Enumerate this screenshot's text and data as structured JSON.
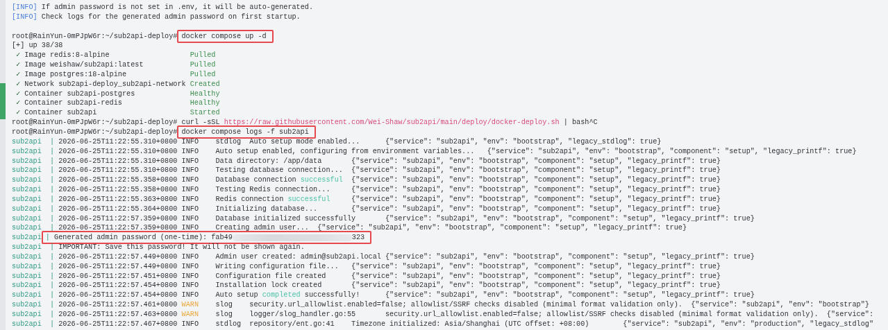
{
  "terminal": {
    "lines": [
      {
        "kind": "text",
        "segments": [
          {
            "text": "[INFO]",
            "kind": "info"
          },
          {
            "text": " If admin password is not set in .env, it will be auto-generated.",
            "kind": "plain"
          }
        ]
      },
      {
        "kind": "text",
        "segments": [
          {
            "text": "[INFO]",
            "kind": "info"
          },
          {
            "text": " Check logs for the generated admin password on first startup.",
            "kind": "plain"
          }
        ]
      },
      {
        "kind": "blank"
      },
      {
        "kind": "text",
        "segments": [
          {
            "text": "root@RainYun-0mPJpW6r:~/sub2api-deploy#",
            "kind": "prompt"
          },
          {
            "kind": "box",
            "segments": [
              {
                "text": "docker compose up -d",
                "kind": "command"
              }
            ]
          }
        ]
      },
      {
        "kind": "text",
        "segments": [
          {
            "text": "[+] up 38/38",
            "kind": "plain"
          }
        ]
      },
      {
        "kind": "text",
        "segments": [
          {
            "text": "✓",
            "kind": "check"
          },
          {
            "text": "Image redis:8-alpine",
            "kind": "resource"
          },
          {
            "text": "Pulled",
            "kind": "status"
          }
        ]
      },
      {
        "kind": "text",
        "segments": [
          {
            "text": "✓",
            "kind": "check"
          },
          {
            "text": "Image weishaw/sub2api:latest",
            "kind": "resource"
          },
          {
            "text": "Pulled",
            "kind": "status"
          }
        ]
      },
      {
        "kind": "text",
        "segments": [
          {
            "text": "✓",
            "kind": "check"
          },
          {
            "text": "Image postgres:18-alpine",
            "kind": "resource"
          },
          {
            "text": "Pulled",
            "kind": "status"
          }
        ]
      },
      {
        "kind": "text",
        "segments": [
          {
            "text": "✓",
            "kind": "check"
          },
          {
            "text": "Network sub2api-deploy_sub2api-network",
            "kind": "resource"
          },
          {
            "text": "Created",
            "kind": "status"
          }
        ]
      },
      {
        "kind": "text",
        "segments": [
          {
            "text": "✓",
            "kind": "check"
          },
          {
            "text": "Container sub2api-postgres",
            "kind": "resource"
          },
          {
            "text": "Healthy",
            "kind": "status"
          }
        ]
      },
      {
        "kind": "text",
        "segments": [
          {
            "text": "✓",
            "kind": "check"
          },
          {
            "text": "Container sub2api-redis",
            "kind": "resource"
          },
          {
            "text": "Healthy",
            "kind": "status"
          }
        ]
      },
      {
        "kind": "text",
        "segments": [
          {
            "text": "✓",
            "kind": "check"
          },
          {
            "text": "Container sub2api",
            "kind": "resource"
          },
          {
            "text": "Started",
            "kind": "status"
          }
        ]
      },
      {
        "kind": "text",
        "segments": [
          {
            "text": "root@RainYun-0mPJpW6r:~/sub2api-deploy#",
            "kind": "prompt"
          },
          {
            "text": " curl -sSL ",
            "kind": "plain"
          },
          {
            "text": "https://raw.githubusercontent.com/Wei-Shaw/sub2api/main/deploy/docker-deploy.sh",
            "kind": "url"
          },
          {
            "text": " | bash^C",
            "kind": "plain"
          }
        ]
      },
      {
        "kind": "text",
        "segments": [
          {
            "text": "root@RainYun-0mPJpW6r:~/sub2api-deploy#",
            "kind": "prompt"
          },
          {
            "kind": "box",
            "segments": [
              {
                "text": "docker compose logs -f sub2api",
                "kind": "command"
              }
            ]
          }
        ]
      },
      {
        "kind": "text",
        "segments": [
          {
            "text": "sub2api  |",
            "kind": "service"
          },
          {
            "text": " 2026-06-25T11:22:55.310+0800\tINFO\tstdlog\tAuto setup mode enabled...\t{\"service\": \"sub2api\", \"env\": \"bootstrap\", \"legacy_stdlog\": true}",
            "kind": "plain"
          }
        ]
      },
      {
        "kind": "text",
        "segments": [
          {
            "text": "sub2api  |",
            "kind": "service"
          },
          {
            "text": " 2026-06-25T11:22:55.310+0800\tINFO\tAuto setup enabled, configuring from environment variables...\t{\"service\": \"sub2api\", \"env\": \"bootstrap\", \"component\": \"setup\", \"legacy_printf\": true}",
            "kind": "plain"
          }
        ]
      },
      {
        "kind": "text",
        "segments": [
          {
            "text": "sub2api  |",
            "kind": "service"
          },
          {
            "text": " 2026-06-25T11:22:55.310+0800\tINFO\tData directory: /app/data\t{\"service\": \"sub2api\", \"env\": \"bootstrap\", \"component\": \"setup\", \"legacy_printf\": true}",
            "kind": "plain"
          }
        ]
      },
      {
        "kind": "text",
        "segments": [
          {
            "text": "sub2api  |",
            "kind": "service"
          },
          {
            "text": " 2026-06-25T11:22:55.310+0800\tINFO\tTesting database connection...\t{\"service\": \"sub2api\", \"env\": \"bootstrap\", \"component\": \"setup\", \"legacy_printf\": true}",
            "kind": "plain"
          }
        ]
      },
      {
        "kind": "text",
        "segments": [
          {
            "text": "sub2api  |",
            "kind": "service"
          },
          {
            "text": " 2026-06-25T11:22:55.358+0800\tINFO\tDatabase connection ",
            "kind": "plain"
          },
          {
            "text": "successful",
            "kind": "success"
          },
          {
            "text": "\t{\"service\": \"sub2api\", \"env\": \"bootstrap\", \"component\": \"setup\", \"legacy_printf\": true}",
            "kind": "plain"
          }
        ]
      },
      {
        "kind": "text",
        "segments": [
          {
            "text": "sub2api  |",
            "kind": "service"
          },
          {
            "text": " 2026-06-25T11:22:55.358+0800\tINFO\tTesting Redis connection...\t{\"service\": \"sub2api\", \"env\": \"bootstrap\", \"component\": \"setup\", \"legacy_printf\": true}",
            "kind": "plain"
          }
        ]
      },
      {
        "kind": "text",
        "segments": [
          {
            "text": "sub2api  |",
            "kind": "service"
          },
          {
            "text": " 2026-06-25T11:22:55.363+0800\tINFO\tRedis connection ",
            "kind": "plain"
          },
          {
            "text": "successful",
            "kind": "success"
          },
          {
            "text": "\t{\"service\": \"sub2api\", \"env\": \"bootstrap\", \"component\": \"setup\", \"legacy_printf\": true}",
            "kind": "plain"
          }
        ]
      },
      {
        "kind": "text",
        "segments": [
          {
            "text": "sub2api  |",
            "kind": "service"
          },
          {
            "text": " 2026-06-25T11:22:55.364+0800\tINFO\tInitializing database...\t{\"service\": \"sub2api\", \"env\": \"bootstrap\", \"component\": \"setup\", \"legacy_printf\": true}",
            "kind": "plain"
          }
        ]
      },
      {
        "kind": "text",
        "segments": [
          {
            "text": "sub2api  |",
            "kind": "service"
          },
          {
            "text": " 2026-06-25T11:22:57.359+0800\tINFO\tDatabase initialized successfully\t{\"service\": \"sub2api\", \"env\": \"bootstrap\", \"component\": \"setup\", \"legacy_printf\": true}",
            "kind": "plain"
          }
        ]
      },
      {
        "kind": "text",
        "segments": [
          {
            "text": "sub2api  |",
            "kind": "service"
          },
          {
            "text": " 2026-06-25T11:22:57.359+0800\tINFO\tCreating admin user...\t{\"service\": \"sub2api\", \"env\": \"bootstrap\", \"component\": \"setup\", \"legacy_printf\": true}",
            "kind": "plain"
          }
        ]
      },
      {
        "kind": "text",
        "segments": [
          {
            "text": "sub2api",
            "kind": "service"
          },
          {
            "kind": "box",
            "segments": [
              {
                "text": "|",
                "kind": "service"
              },
              {
                "text": " Generated admin password (one-time): fab49",
                "kind": "plain"
              },
              {
                "kind": "redacted"
              },
              {
                "text": "323",
                "kind": "plain"
              }
            ]
          }
        ]
      },
      {
        "kind": "text",
        "segments": [
          {
            "text": "sub2api  |",
            "kind": "service"
          },
          {
            "text": " IMPORTANT: Save this password! It will not be shown again.",
            "kind": "plain"
          }
        ]
      },
      {
        "kind": "text",
        "segments": [
          {
            "text": "sub2api  |",
            "kind": "service"
          },
          {
            "text": " 2026-06-25T11:22:57.449+0800\tINFO\tAdmin user created: admin@sub2api.local\t{\"service\": \"sub2api\", \"env\": \"bootstrap\", \"component\": \"setup\", \"legacy_printf\": true}",
            "kind": "plain"
          }
        ]
      },
      {
        "kind": "text",
        "segments": [
          {
            "text": "sub2api  |",
            "kind": "service"
          },
          {
            "text": " 2026-06-25T11:22:57.449+0800\tINFO\tWriting configuration file...\t{\"service\": \"sub2api\", \"env\": \"bootstrap\", \"component\": \"setup\", \"legacy_printf\": true}",
            "kind": "plain"
          }
        ]
      },
      {
        "kind": "text",
        "segments": [
          {
            "text": "sub2api  |",
            "kind": "service"
          },
          {
            "text": " 2026-06-25T11:22:57.451+0800\tINFO\tConfiguration file created\t{\"service\": \"sub2api\", \"env\": \"bootstrap\", \"component\": \"setup\", \"legacy_printf\": true}",
            "kind": "plain"
          }
        ]
      },
      {
        "kind": "text",
        "segments": [
          {
            "text": "sub2api  |",
            "kind": "service"
          },
          {
            "text": " 2026-06-25T11:22:57.454+0800\tINFO\tInstallation lock created\t{\"service\": \"sub2api\", \"env\": \"bootstrap\", \"component\": \"setup\", \"legacy_printf\": true}",
            "kind": "plain"
          }
        ]
      },
      {
        "kind": "text",
        "segments": [
          {
            "text": "sub2api  |",
            "kind": "service"
          },
          {
            "text": " 2026-06-25T11:22:57.454+0800\tINFO\tAuto setup ",
            "kind": "plain"
          },
          {
            "text": "completed",
            "kind": "success"
          },
          {
            "text": " successfully!\t{\"service\": \"sub2api\", \"env\": \"bootstrap\", \"component\": \"setup\", \"legacy_printf\": true}",
            "kind": "plain"
          }
        ]
      },
      {
        "kind": "text",
        "segments": [
          {
            "text": "sub2api  |",
            "kind": "service"
          },
          {
            "text": " 2026-06-25T11:22:57.461+0800\t",
            "kind": "plain"
          },
          {
            "text": "WARN",
            "kind": "warn"
          },
          {
            "text": "\tslog\tsecurity.url_allowlist.enabled=false; allowlist/SSRF checks disabled (minimal format validation only).\t{\"service\": \"sub2api\", \"env\": \"bootstrap\"}",
            "kind": "plain"
          }
        ]
      },
      {
        "kind": "text",
        "segments": [
          {
            "text": "sub2api  |",
            "kind": "service"
          },
          {
            "text": " 2026-06-25T11:22:57.463+0800\t",
            "kind": "plain"
          },
          {
            "text": "WARN",
            "kind": "warn"
          },
          {
            "text": "\tslog\tlogger/slog_handler.go:55\tsecurity.url_allowlist.enabled=false; allowlist/SSRF checks disabled (minimal format validation only).\t{\"service\":",
            "kind": "plain"
          }
        ]
      },
      {
        "kind": "text",
        "segments": [
          {
            "text": "sub2api  |",
            "kind": "service"
          },
          {
            "text": " 2026-06-25T11:22:57.467+0800\tINFO\tstdlog\trepository/ent.go:41\tTimezone initialized: Asia/Shanghai (UTC offset: +08:00)\t{\"service\": \"sub2api\", \"env\": \"production\", \"legacy_stdlog\"",
            "kind": "plain"
          }
        ]
      }
    ]
  }
}
